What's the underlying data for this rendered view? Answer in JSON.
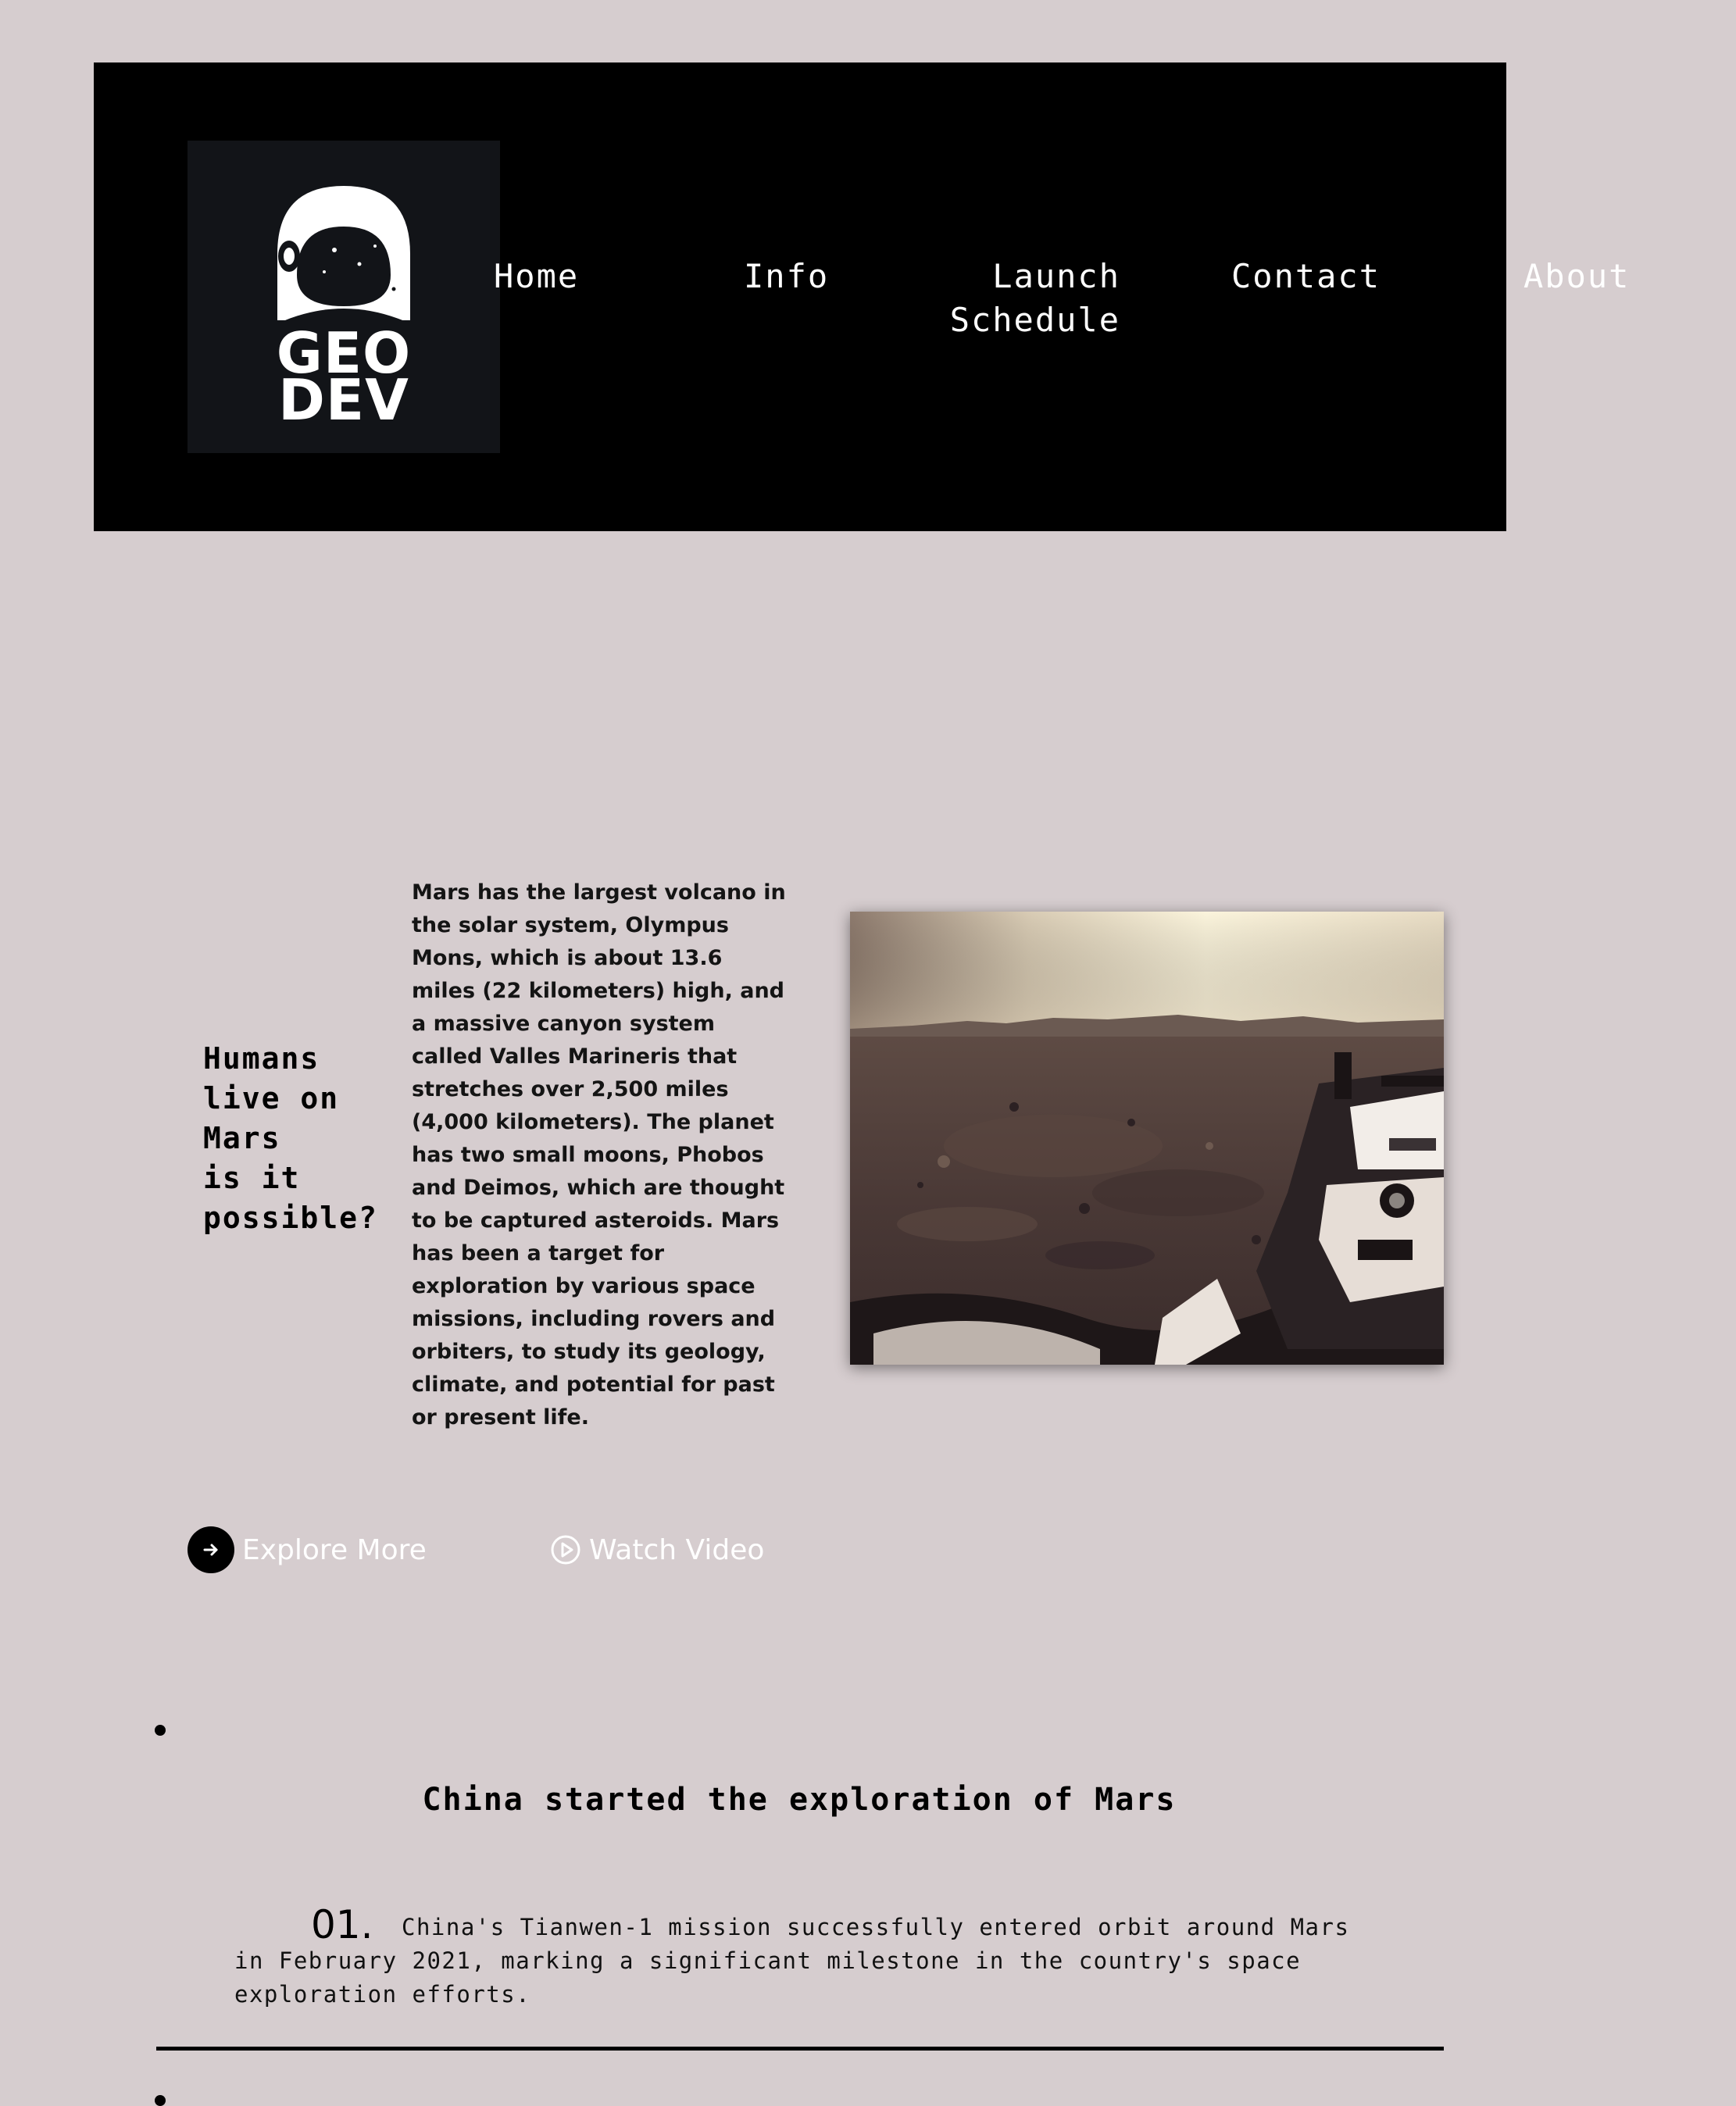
{
  "logo": {
    "line1": "GEO",
    "line2": "DEV",
    "icon": "astronaut-helmet-icon"
  },
  "nav": {
    "home": "Home",
    "info": "Info",
    "launch": "Launch Schedule",
    "contact": "Contact",
    "about": "About"
  },
  "hero": {
    "headline": [
      "Humans",
      "live on",
      "Mars",
      "is it",
      "possible?"
    ],
    "body": "Mars has the largest volcano in the solar system, Olympus Mons, which is about 13.6 miles (22 kilometers) high, and a massive canyon system called Valles Marineris that stretches over 2,500 miles (4,000 kilometers). The planet has two small moons, Phobos and Deimos, which are thought to be captured asteroids. Mars has been a target for exploration by various space missions, including rovers and orbiters, to study its geology, climate, and potential for past or present life."
  },
  "actions": {
    "explore": "Explore More",
    "watch": "Watch Video",
    "explore_icon": "arrow-right-circle-icon",
    "watch_icon": "play-circle-icon"
  },
  "section": {
    "title": "China started the exploration of Mars",
    "items": [
      {
        "number": "01.",
        "text": "China's Tianwen-1 mission successfully entered orbit around Mars in February 2021, marking a significant milestone in the country's space exploration efforts."
      }
    ]
  },
  "colors": {
    "background": "#d6cdcf",
    "header": "#000000",
    "logo_box": "#121418"
  }
}
